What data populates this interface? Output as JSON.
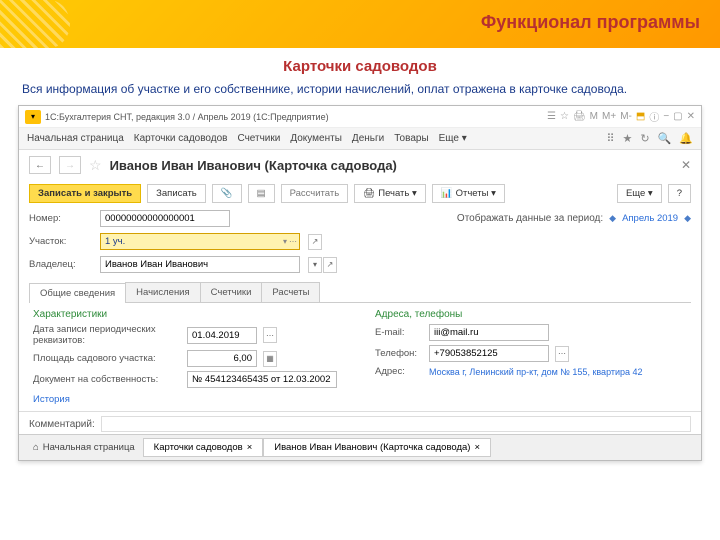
{
  "slide": {
    "title": "Функционал программы",
    "subtitle": "Карточки садоводов",
    "desc": "Вся информация об участке и его собственнике, истории начислений, оплат отражена в карточке садовода."
  },
  "window": {
    "title": "1С:Бухгалтерия СНТ, редакция 3.0 / Апрель 2019  (1С:Предприятие)"
  },
  "navbar": {
    "items": [
      "Начальная страница",
      "Карточки садоводов",
      "Счетчики",
      "Документы",
      "Деньги",
      "Товары",
      "Еще ▾"
    ]
  },
  "card": {
    "title": "Иванов Иван Иванович (Карточка садовода)"
  },
  "toolbar": {
    "save_close": "Записать и закрыть",
    "save": "Записать",
    "calc": "Рассчитать",
    "print": "Печать ▾",
    "reports": "Отчеты ▾",
    "more": "Еще ▾"
  },
  "form": {
    "number_label": "Номер:",
    "number_val": "00000000000000001",
    "period_label": "Отображать данные за период:",
    "period_val": "Апрель 2019",
    "plot_label": "Участок:",
    "plot_val": "1 уч.",
    "owner_label": "Владелец:",
    "owner_val": "Иванов Иван Иванович"
  },
  "tabs": [
    "Общие сведения",
    "Начисления",
    "Счетчики",
    "Расчеты"
  ],
  "general": {
    "left_head": "Характеристики",
    "right_head": "Адреса, телефоны",
    "date_label": "Дата записи периодических реквизитов:",
    "date_val": "01.04.2019",
    "area_label": "Площадь садового участка:",
    "area_val": "6,00",
    "doc_label": "Документ на собственность:",
    "doc_val": "№ 454123465435 от 12.03.2002",
    "history": "История",
    "email_label": "E-mail:",
    "email_val": "iii@mail.ru",
    "phone_label": "Телефон:",
    "phone_val": "+79053852125",
    "addr_label": "Адрес:",
    "addr_val": "Москва г, Ленинский пр-кт, дом № 155, квартира 42"
  },
  "comment": {
    "label": "Комментарий:"
  },
  "bottom": {
    "home": "Начальная страница",
    "t1": "Карточки садоводов",
    "t2": "Иванов Иван Иванович (Карточка садовода)"
  }
}
